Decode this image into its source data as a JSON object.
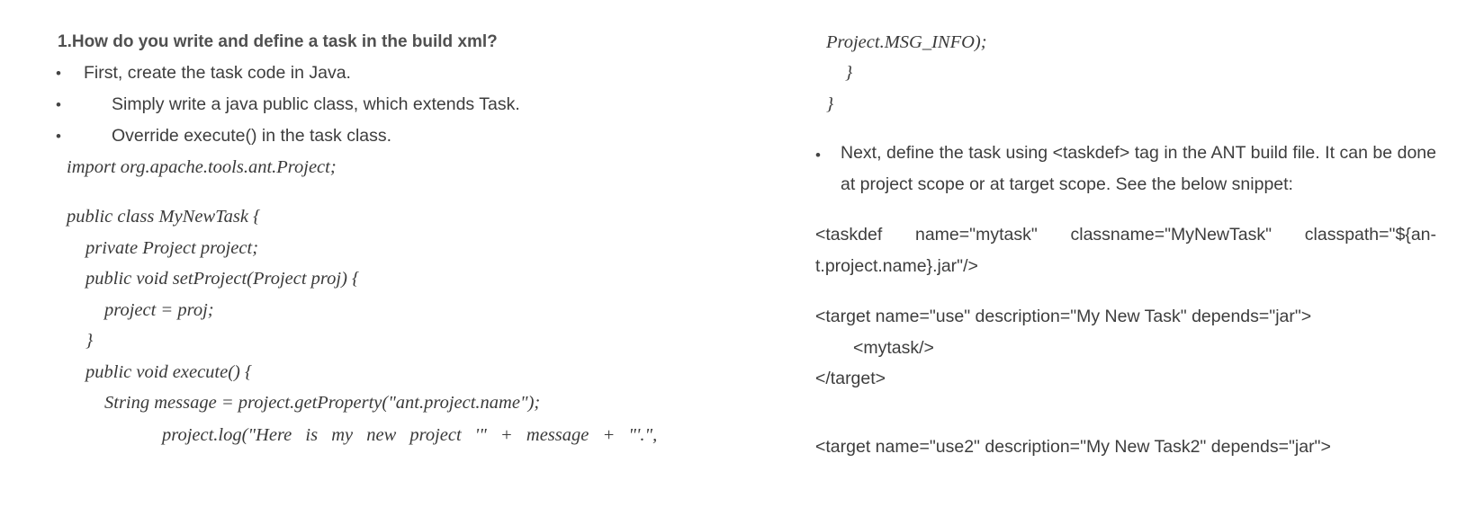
{
  "left": {
    "heading": "1.How do you write and define a task in the build xml?",
    "bullets": [
      "First, create the task code in Java.",
      "Simply write a java public class, which extends Task.",
      "Override execute() in the task class."
    ],
    "code_lines": [
      "import org.apache.tools.ant.Project;",
      "public class MyNewTask {",
      "private Project project;",
      "public void setProject(Project proj) {",
      "project = proj;",
      "}",
      "public void execute() {",
      "String message = project.getProperty(\"ant.project.name\");",
      "project.log(\"Here is my new project '\" + message + \"'.\","
    ]
  },
  "right": {
    "code_lines": [
      "Project.MSG_INFO);",
      "}",
      "}"
    ],
    "bullet_text": "Next, define the task using <taskdef> tag in the ANT build file. It can be done at project scope or at target scope. See the below snippet:",
    "taskdef_line1": "<taskdef name=\"mytask\" classname=\"MyNewTask\" classpath=\"${an-",
    "taskdef_line2": "t.project.name}.jar\"/>",
    "target1_open": "<target name=\"use\" description=\"My New Task\" depends=\"jar\">",
    "target1_inner": "<mytask/>",
    "target1_close": "</target>",
    "target2_open": "<target name=\"use2\" description=\"My New Task2\" depends=\"jar\">"
  }
}
